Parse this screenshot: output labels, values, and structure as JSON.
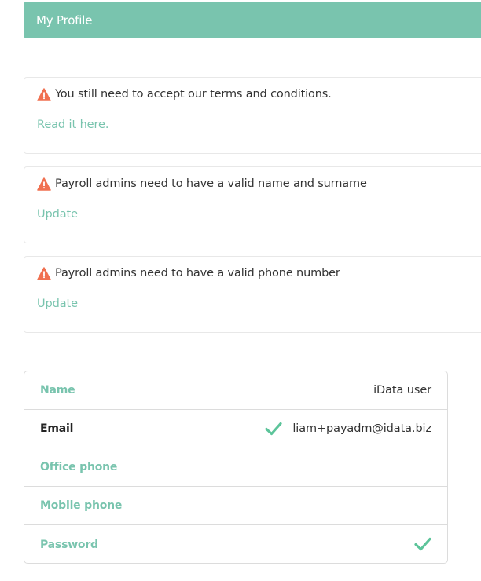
{
  "header": {
    "title": "My Profile"
  },
  "alerts": [
    {
      "message": "You still need to accept our terms and conditions.",
      "link": "Read it here."
    },
    {
      "message": "Payroll admins need to have a valid name and surname",
      "link": "Update"
    },
    {
      "message": "Payroll admins need to have a valid phone number",
      "link": "Update"
    }
  ],
  "profile": {
    "name": {
      "label": "Name",
      "value": "iData user"
    },
    "email": {
      "label": "Email",
      "value": "liam+payadm@idata.biz",
      "verified": true
    },
    "office_phone": {
      "label": "Office phone",
      "value": ""
    },
    "mobile_phone": {
      "label": "Mobile phone",
      "value": ""
    },
    "password": {
      "label": "Password",
      "set": true
    }
  },
  "colors": {
    "accent": "#79c4ae",
    "warning": "#f07050",
    "check": "#5cc49a",
    "border": "#dcdcdc"
  },
  "icons": {
    "warning": "warning-triangle-icon",
    "check": "check-icon"
  }
}
